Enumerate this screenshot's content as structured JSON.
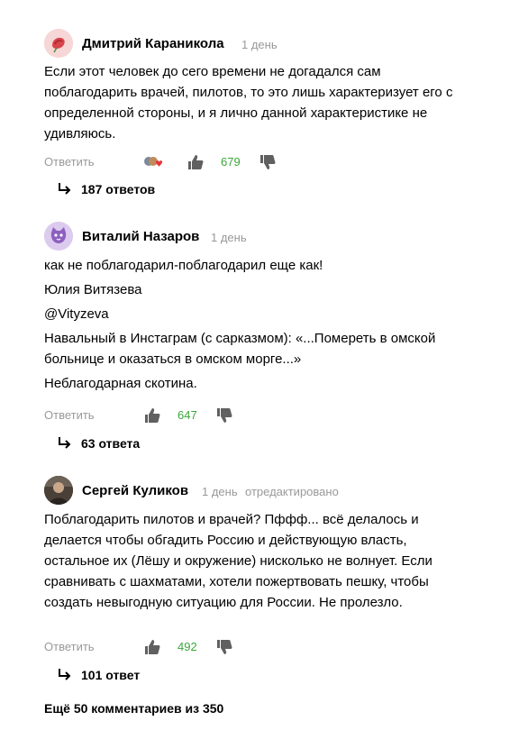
{
  "comments": [
    {
      "author": "Дмитрий Караникола",
      "time": "1 день",
      "edited": "",
      "paragraphs": [
        "Если этот человек до сего времени не догадался сам поблагодарить врачей, пилотов, то это лишь характеризует его с определенной стороны, и я лично данной характеристике не удивляюсь."
      ],
      "reply_label": "Ответить",
      "likes": "679",
      "replies": "187 ответов",
      "avatar_icon": "rose-icon"
    },
    {
      "author": "Виталий Назаров",
      "time": "1 день",
      "edited": "",
      "paragraphs": [
        "как не поблагодарил-поблагодарил еще как!",
        "Юлия Витязева",
        "@Vityzeva",
        "Навальный в Инстаграм (с сарказмом): «...Помереть в омской больнице и оказаться в омском морге...»",
        "Неблагодарная скотина."
      ],
      "reply_label": "Ответить",
      "likes": "647",
      "replies": "63 ответа",
      "avatar_icon": "cat-icon"
    },
    {
      "author": "Сергей Куликов",
      "time": "1 день",
      "edited": "отредактировано",
      "paragraphs": [
        "Поблагодарить пилотов и врачей? Пффф... всё делалось и делается чтобы обгадить Россию и действующую власть, остальное их (Лёшу и окружение) нисколько не волнует. Если сравнивать с шахматами, хотели пожертвовать пешку, чтобы создать невыгодную ситуацию для России. Не пролезло."
      ],
      "reply_label": "Ответить",
      "likes": "492",
      "replies": "101 ответ",
      "avatar_icon": "photo-avatar-icon"
    }
  ],
  "more_comments": "Ещё 50 комментариев из 350",
  "colors": {
    "likes": "#3aa73a",
    "meta": "#999999"
  }
}
